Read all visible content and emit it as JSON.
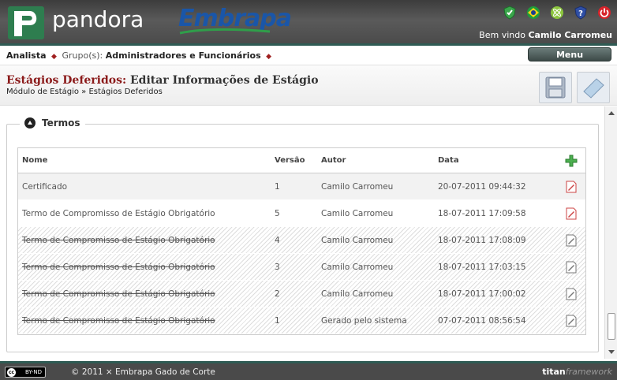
{
  "header": {
    "brand": "pandora",
    "partner": "Embrapa",
    "welcome_prefix": "Bem vindo",
    "user_name": "Camilo Carromeu"
  },
  "groupbar": {
    "role": "Analista",
    "groups_label": "Grupo(s):",
    "groups": "Administradores e Funcionários",
    "menu_label": "Menu"
  },
  "page": {
    "title_highlight": "Estágios Deferidos:",
    "title_rest": "Editar Informações de Estágio",
    "breadcrumb": "Módulo de Estágio » Estágios Deferidos"
  },
  "section": {
    "legend": "Termos"
  },
  "table": {
    "headers": {
      "name": "Nome",
      "version": "Versão",
      "author": "Autor",
      "date": "Data"
    },
    "rows": [
      {
        "name": "Certificado",
        "version": "1",
        "author": "Camilo Carromeu",
        "date": "20-07-2011 09:44:32",
        "deleted": false
      },
      {
        "name": "Termo de Compromisso de Estágio Obrigatório",
        "version": "5",
        "author": "Camilo Carromeu",
        "date": "18-07-2011 17:09:58",
        "deleted": false
      },
      {
        "name": "Termo de Compromisso de Estágio Obrigatório",
        "version": "4",
        "author": "Camilo Carromeu",
        "date": "18-07-2011 17:08:09",
        "deleted": true
      },
      {
        "name": "Termo de Compromisso de Estágio Obrigatório",
        "version": "3",
        "author": "Camilo Carromeu",
        "date": "18-07-2011 17:03:15",
        "deleted": true
      },
      {
        "name": "Termo de Compromisso de Estágio Obrigatório",
        "version": "2",
        "author": "Camilo Carromeu",
        "date": "18-07-2011 17:00:02",
        "deleted": true
      },
      {
        "name": "Termo de Compromisso de Estágio Obrigatório",
        "version": "1",
        "author": "Gerado pelo sistema",
        "date": "07-07-2011 08:56:54",
        "deleted": true
      }
    ]
  },
  "footer": {
    "license": "BY-ND",
    "copyright": "© 2011 × Embrapa Gado de Corte",
    "framework_a": "titan",
    "framework_b": "framework"
  },
  "icons": {
    "header": [
      "shield-icon",
      "brazil-flag-icon",
      "atom-icon",
      "help-shield-icon",
      "power-icon"
    ],
    "add": "plus-icon",
    "edit_active": "pdf-pen-icon",
    "edit_inactive": "pen-gray-icon"
  },
  "colors": {
    "title_red": "#8b1a1a",
    "header_bg": "#4a4a4a",
    "accent_teal": "#2f5b54"
  }
}
